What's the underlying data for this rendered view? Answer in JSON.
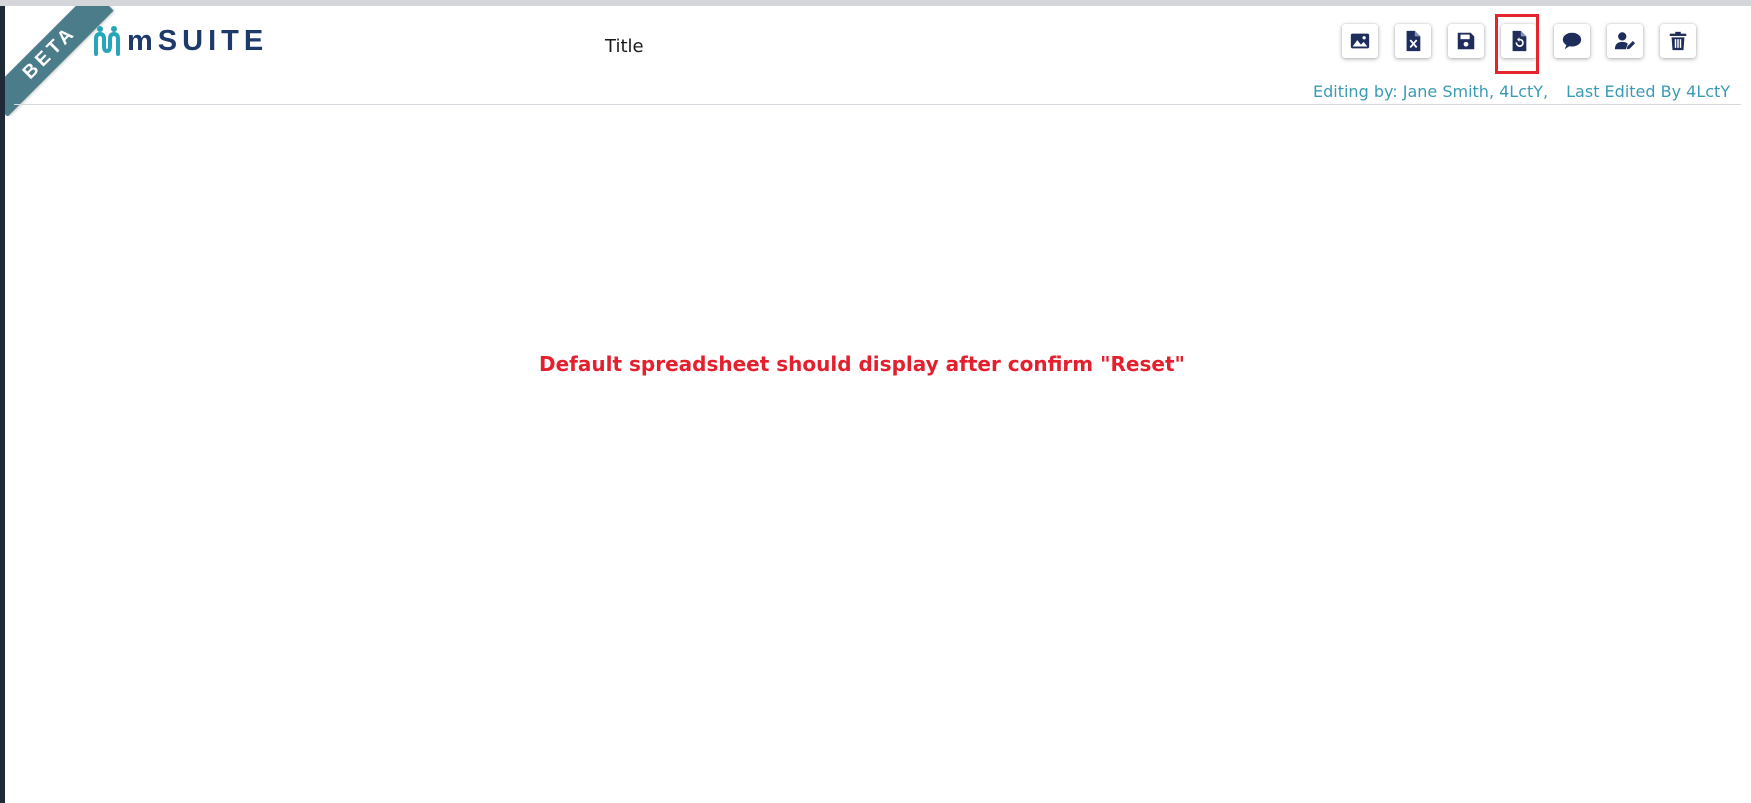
{
  "ribbon": {
    "text": "BETA"
  },
  "logo": {
    "text": "mSUITE"
  },
  "header": {
    "title": "Title"
  },
  "toolbar": {
    "buttons": [
      {
        "icon": "image-icon"
      },
      {
        "icon": "excel-file-icon"
      },
      {
        "icon": "save-icon"
      },
      {
        "icon": "reset-icon",
        "highlighted": true
      },
      {
        "icon": "comment-icon"
      },
      {
        "icon": "user-edit-icon"
      },
      {
        "icon": "trash-icon"
      }
    ]
  },
  "status": {
    "editing_by": "Editing by: Jane Smith, 4LctY,",
    "last_edited": "Last Edited By 4LctY"
  },
  "annotation": {
    "text": "Default spreadsheet should display after confirm \"Reset\""
  },
  "colors": {
    "icon": "#1e2d5c",
    "accent_teal": "#3a9bb5",
    "ribbon": "#4a7c8a",
    "annotation_red": "#e5202e",
    "logo_text": "#1e3a6a"
  }
}
